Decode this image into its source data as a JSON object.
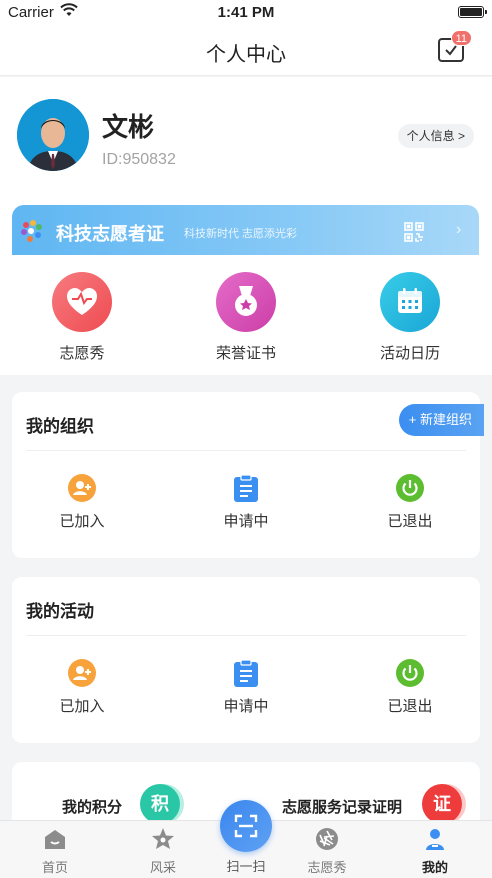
{
  "status_bar": {
    "carrier": "Carrier",
    "time": "1:41 PM"
  },
  "header": {
    "title": "个人中心",
    "message_badge": "11"
  },
  "profile": {
    "name": "文彬",
    "id_text": "ID:950832",
    "info_button": "个人信息 >"
  },
  "certificate": {
    "title": "科技志愿者证",
    "slogan": "科技新时代  志愿添光彩",
    "arrow": "›"
  },
  "quick_links": [
    {
      "label": "志愿秀",
      "color": "#f0585c",
      "icon": "heart-icon"
    },
    {
      "label": "荣誉证书",
      "color": "#d94fb7",
      "icon": "medal-icon"
    },
    {
      "label": "活动日历",
      "color": "#26b6e0",
      "icon": "calendar-icon"
    }
  ],
  "my_orgs": {
    "title": "我的组织",
    "new_button": "+ 新建组织",
    "items": [
      {
        "label": "已加入",
        "icon": "add-user-icon",
        "color": "#f7a23b"
      },
      {
        "label": "申请中",
        "icon": "clipboard-icon",
        "color": "#3a8ff0"
      },
      {
        "label": "已退出",
        "icon": "power-icon",
        "color": "#5bbd2f"
      }
    ]
  },
  "my_activities": {
    "title": "我的活动",
    "items": [
      {
        "label": "已加入",
        "icon": "add-user-icon",
        "color": "#f7a23b"
      },
      {
        "label": "申请中",
        "icon": "clipboard-icon",
        "color": "#3a8ff0"
      },
      {
        "label": "已退出",
        "icon": "power-icon",
        "color": "#5bbd2f"
      }
    ]
  },
  "points": {
    "points_label": "我的积分",
    "points_badge": "积",
    "record_label": "志愿服务记录证明",
    "record_badge": "证"
  },
  "tabbar": {
    "tabs": [
      {
        "label": "首页",
        "icon": "home-icon"
      },
      {
        "label": "风采",
        "icon": "star-icon"
      },
      {
        "label": "扫一扫",
        "icon": "scan-icon"
      },
      {
        "label": "志愿秀",
        "icon": "aperture-icon"
      },
      {
        "label": "我的",
        "icon": "user-icon",
        "active": true
      }
    ]
  }
}
